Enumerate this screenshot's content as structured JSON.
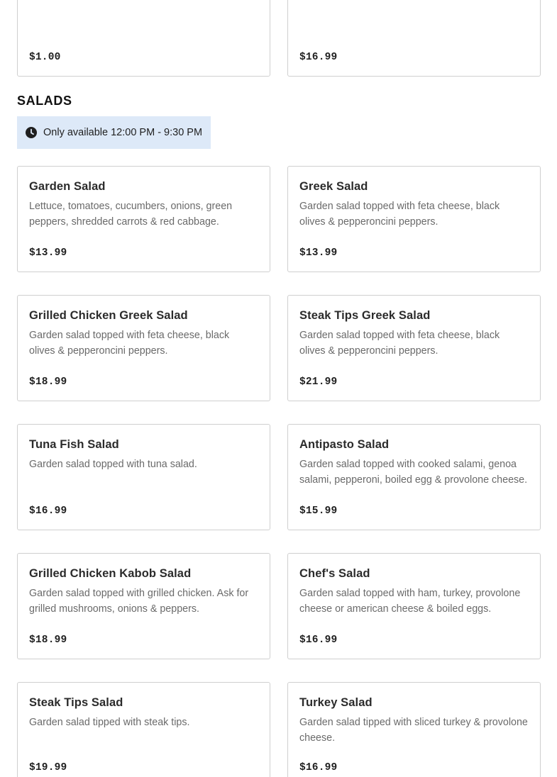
{
  "previous_section": {
    "items": [
      {
        "price": "$1.00"
      },
      {
        "price": "$16.99"
      }
    ]
  },
  "salads": {
    "title": "SALADS",
    "availability": "Only available 12:00 PM - 9:30 PM",
    "availability_icon": "clock-icon",
    "items": [
      {
        "name": "Garden Salad",
        "description": "Lettuce, tomatoes, cucumbers, onions, green peppers, shredded carrots & red cabbage.",
        "price": "$13.99"
      },
      {
        "name": "Greek Salad",
        "description": "Garden salad topped with feta cheese, black olives & pepperoncini peppers.",
        "price": "$13.99"
      },
      {
        "name": "Grilled Chicken Greek Salad",
        "description": "Garden salad topped with feta cheese, black olives & pepperoncini peppers.",
        "price": "$18.99"
      },
      {
        "name": "Steak Tips Greek Salad",
        "description": "Garden salad topped with feta cheese, black olives & pepperoncini peppers.",
        "price": "$21.99"
      },
      {
        "name": "Tuna Fish Salad",
        "description": "Garden salad topped with tuna salad.",
        "price": "$16.99"
      },
      {
        "name": "Antipasto Salad",
        "description": "Garden salad topped with cooked salami, genoa salami, pepperoni, boiled egg & provolone cheese.",
        "price": "$15.99"
      },
      {
        "name": "Grilled Chicken Kabob Salad",
        "description": "Garden salad topped with grilled chicken. Ask for grilled mushrooms, onions & peppers.",
        "price": "$18.99"
      },
      {
        "name": "Chef's Salad",
        "description": "Garden salad topped with ham, turkey, provolone cheese or american cheese & boiled eggs.",
        "price": "$16.99"
      },
      {
        "name": "Steak Tips Salad",
        "description": "Garden salad tipped with steak tips.",
        "price": "$19.99"
      },
      {
        "name": "Turkey Salad",
        "description": "Garden salad tipped with sliced turkey & provolone cheese.",
        "price": "$16.99"
      }
    ]
  },
  "colors": {
    "availability_bg": "#dde9f8",
    "card_border": "#cfcfcf",
    "description_text": "#6a6a6a"
  }
}
